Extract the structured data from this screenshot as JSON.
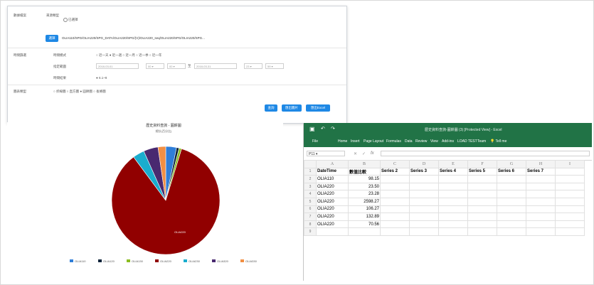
{
  "panel": {
    "row1_label": "數據檔案",
    "row1_sublabel": "來源類型",
    "row1_option": "已選擇",
    "select_button": "選擇",
    "file_path": "OLIA110/SPG/OLIA220/SPG_DATA/OLIA220/SPG/(V)/OLIA220_seq/OLIA220/SPG/OLIA220/SPG...",
    "row2_label": "時間篩選",
    "time_mode_label": "時間模式",
    "time_mode_options": "○ 近一天 ● 近一週 ○ 近一月 ○ 近一季 ○ 近一年",
    "date_range_label": "指定範圍",
    "date_from": "2018-03-01",
    "hour_from": "00",
    "minute_from": "00",
    "date_sep": "至",
    "date_to": "2018-03-31",
    "hour_to": "23",
    "minute_to": "59",
    "result_label": "時間結果",
    "result_value": "● 6.1~8",
    "row3_label": "圖表類型",
    "chart_options": "○ 折線圖 ○ 直方圖 ● 圓餅圖 ○ 長條圖",
    "buttons": [
      "查詢",
      "匯出圖片",
      "匯出Excel"
    ]
  },
  "chart_data": {
    "type": "pie",
    "title": "歷史資料查詢 - 圓餅圖",
    "subtitle": "總計(百分比)",
    "labels": [
      "OLIA110",
      "OLIA120",
      "OLIA130",
      "OLIA220",
      "OLIA230",
      "OLIA320",
      "OLIA330"
    ],
    "values": [
      98.15,
      23.5,
      23.28,
      2598.27,
      106.27,
      132.89,
      70.56
    ],
    "colors": [
      "#2f7ed8",
      "#0d233a",
      "#8bbc21",
      "#910000",
      "#1aadce",
      "#492970",
      "#f28f43"
    ],
    "slice_label": "OLIA220",
    "legend_position": "bottom"
  },
  "excel": {
    "title": "歷史資料查詢-圓餅圖 (3) [Protected View] - Excel",
    "ribbon_tabs": [
      "File",
      "Home",
      "Insert",
      "Page Layout",
      "Formulas",
      "Data",
      "Review",
      "View",
      "Add-ins",
      "LOAD TEST",
      "Team",
      "Tell me"
    ],
    "name_box": "P11",
    "fx": "fx",
    "columns": [
      "A",
      "B",
      "C",
      "D",
      "E",
      "F",
      "G",
      "H",
      "I"
    ],
    "headers": [
      "DateTime",
      "數值比較",
      "Series 2",
      "Series 3",
      "Series 4",
      "Series 5",
      "Series 6",
      "Series 7",
      ""
    ],
    "rows": [
      [
        "OLIA110",
        "98.15"
      ],
      [
        "OLIA220",
        "23.50"
      ],
      [
        "OLIA220",
        "23.28"
      ],
      [
        "OLIA220",
        "2598.27"
      ],
      [
        "OLIA220",
        "106.27"
      ],
      [
        "OLIA220",
        "132.89"
      ],
      [
        "OLIA220",
        "70.56"
      ]
    ],
    "colors": {
      "brand": "#217346"
    }
  }
}
